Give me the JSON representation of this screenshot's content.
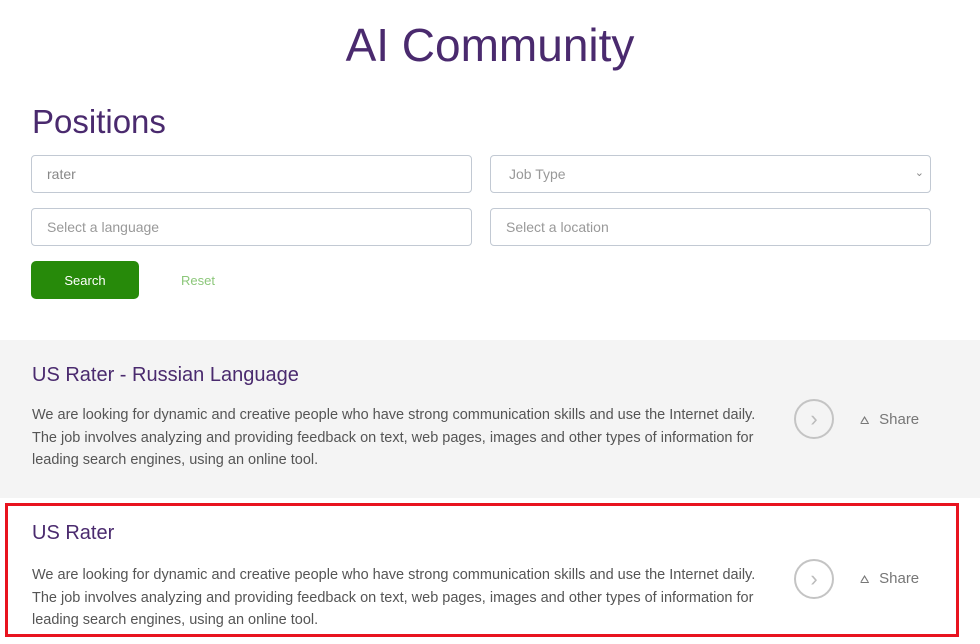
{
  "header": {
    "title": "AI Community",
    "section": "Positions"
  },
  "filters": {
    "keyword_value": "rater",
    "job_type_placeholder": "Job Type",
    "language_placeholder": "Select a language",
    "location_placeholder": "Select a location",
    "search_label": "Search",
    "reset_label": "Reset"
  },
  "jobs": [
    {
      "title": "US Rater - Russian Language",
      "description": "We are looking for dynamic and creative people who have strong communication skills and use the Internet daily. The job involves analyzing and providing feedback on text, web pages, images and other types of information for leading search engines, using an online tool.",
      "share_label": "Share"
    },
    {
      "title": "US Rater",
      "description": "We are looking for dynamic and creative people who have strong communication skills and use the Internet daily. The job involves analyzing and providing feedback on text, web pages, images and other types of information for leading search engines, using an online tool.",
      "share_label": "Share"
    }
  ],
  "colors": {
    "brand": "#4a2a6e",
    "search_button": "#278a0a",
    "highlight": "#e8131f"
  }
}
